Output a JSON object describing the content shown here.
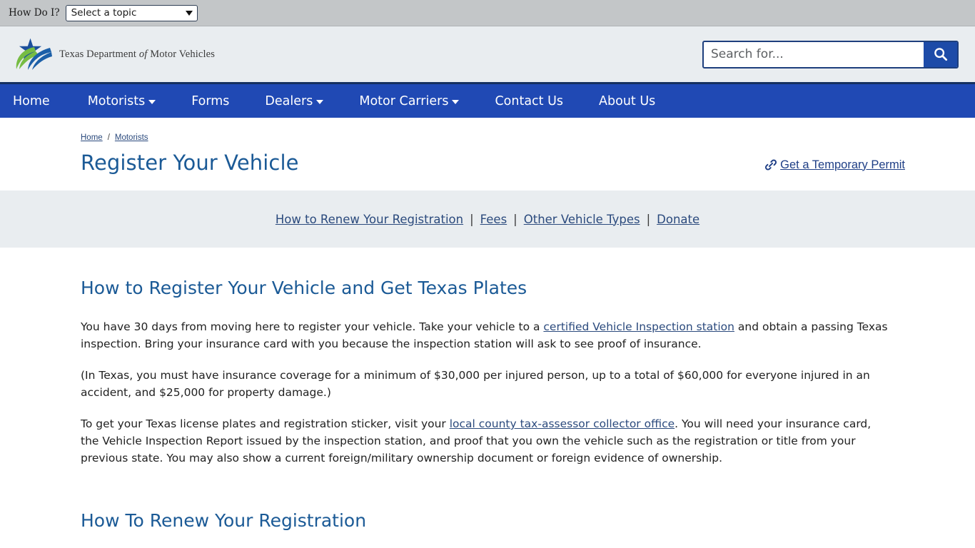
{
  "utility": {
    "label": "How Do I?",
    "select_value": "Select a topic",
    "caret_icon": "chevron-down-icon"
  },
  "header": {
    "logo_text_pre": "Texas Department ",
    "logo_text_italic": "of",
    "logo_text_post": " Motor Vehicles",
    "logo_colors": {
      "star_blue": "#1b4f9c",
      "swoosh_green": "#76bc43",
      "swoosh_blue": "#1b5fa8"
    },
    "search": {
      "placeholder": "Search for...",
      "value": "",
      "button_icon": "search-icon"
    }
  },
  "nav": {
    "accent_color": "#2049b4",
    "items": [
      {
        "label": "Home",
        "has_dropdown": false
      },
      {
        "label": "Motorists",
        "has_dropdown": true
      },
      {
        "label": "Forms",
        "has_dropdown": false
      },
      {
        "label": "Dealers",
        "has_dropdown": true
      },
      {
        "label": "Motor Carriers",
        "has_dropdown": true
      },
      {
        "label": "Contact Us",
        "has_dropdown": false
      },
      {
        "label": "About Us",
        "has_dropdown": false
      }
    ]
  },
  "breadcrumb": {
    "items": [
      {
        "label": "Home"
      },
      {
        "label": "Motorists"
      }
    ],
    "separator": "/"
  },
  "page": {
    "title": "Register Your Vehicle",
    "permit_link": {
      "label": "Get a Temporary Permit",
      "icon": "link-chain-icon"
    }
  },
  "subnav": {
    "links": [
      {
        "label": "How to Renew Your Registration"
      },
      {
        "label": "Fees"
      },
      {
        "label": "Other Vehicle Types"
      },
      {
        "label": "Donate"
      }
    ],
    "separator": "|"
  },
  "main": {
    "heading1": "How to Register Your Vehicle and Get Texas Plates",
    "p1_part1": "You have 30 days from moving here to register your vehicle. Take your vehicle to a ",
    "p1_link": "certified Vehicle Inspection station",
    "p1_part2": " and obtain a passing Texas inspection. Bring your insurance card with you because the inspection station will ask to see proof of insurance.",
    "p2": "(In Texas, you must have insurance coverage for a minimum of $30,000 per injured person, up to a total of $60,000 for everyone injured in an accident, and $25,000 for property damage.)",
    "p3_part1": "To get your Texas license plates and registration sticker, visit your ",
    "p3_link": "local county tax-assessor collector office",
    "p3_part2": ". You will need your insurance card, the Vehicle Inspection Report issued by the inspection station, and proof that you own the vehicle such as the registration or title from your previous state. You may also show a current foreign/military ownership document or foreign evidence of ownership.",
    "heading2": "How To Renew Your Registration"
  }
}
